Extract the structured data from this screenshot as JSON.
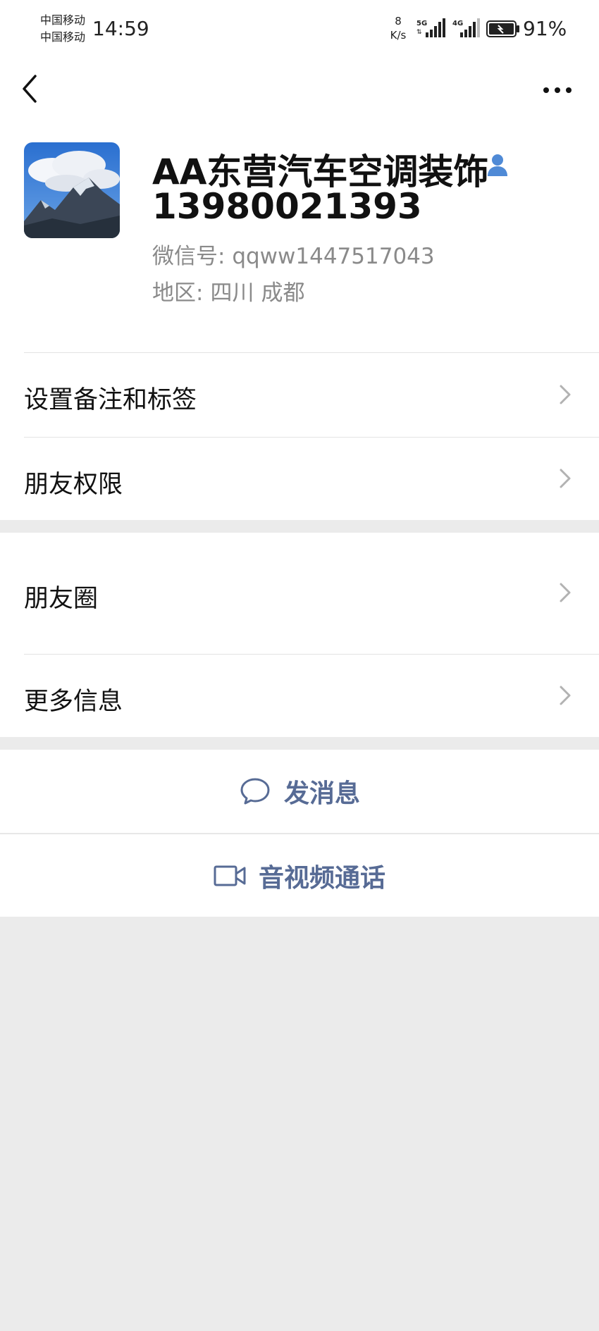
{
  "status_bar": {
    "carrier_1": "中国移动",
    "carrier_2": "中国移动",
    "time": "14:59",
    "net_speed_value": "8",
    "net_speed_unit": "K/s",
    "signal_1_label": "5G",
    "signal_2_label": "4G",
    "battery_percent": "91%"
  },
  "nav": {
    "back_icon": "chevron-left-icon",
    "more_icon": "more-dots-icon"
  },
  "profile": {
    "name": "AA东营汽车空调装饰",
    "phone": "13980021393",
    "wechat_id_label": "微信号:",
    "wechat_id": "qqww1447517043",
    "region_label": "地区:",
    "region_province": "四川",
    "region_city": "成都"
  },
  "rows": {
    "remark_tags": "设置备注和标签",
    "friend_permissions": "朋友权限",
    "moments": "朋友圈",
    "more_info": "更多信息"
  },
  "actions": {
    "send_message": "发消息",
    "voice_video_call": "音视频通话"
  },
  "colors": {
    "accent": "#576b95",
    "background": "#ebebeb",
    "surface": "#ffffff",
    "secondary_text": "#8a8a8a"
  }
}
